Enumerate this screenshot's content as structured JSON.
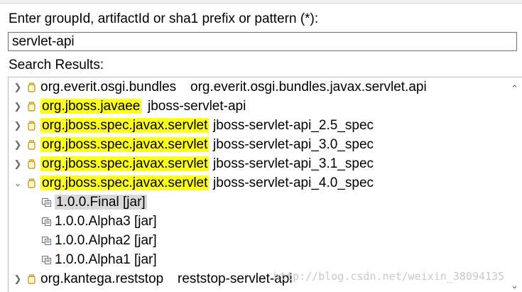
{
  "prompt_label": "Enter groupId, artifactId or sha1 prefix or pattern (*):",
  "search": {
    "value": "servlet-api"
  },
  "results_label": "Search Results:",
  "results": [
    {
      "group": "org.everit.osgi.bundles",
      "artifact": "org.everit.osgi.bundles.javax.servlet.api",
      "highlight": false,
      "expanded": false
    },
    {
      "group": "org.jboss.javaee",
      "artifact": "jboss-servlet-api",
      "highlight": true,
      "expanded": false
    },
    {
      "group": "org.jboss.spec.javax.servlet",
      "artifact": "jboss-servlet-api_2.5_spec",
      "highlight": true,
      "expanded": false
    },
    {
      "group": "org.jboss.spec.javax.servlet",
      "artifact": "jboss-servlet-api_3.0_spec",
      "highlight": true,
      "expanded": false
    },
    {
      "group": "org.jboss.spec.javax.servlet",
      "artifact": "jboss-servlet-api_3.1_spec",
      "highlight": true,
      "expanded": false
    },
    {
      "group": "org.jboss.spec.javax.servlet",
      "artifact": "jboss-servlet-api_4.0_spec",
      "highlight": true,
      "expanded": true
    },
    {
      "group": "org.kantega.reststop",
      "artifact": "reststop-servlet-api",
      "highlight": false,
      "expanded": false
    }
  ],
  "versions": [
    {
      "label": "1.0.0.Final [jar]",
      "selected": true
    },
    {
      "label": "1.0.0.Alpha3 [jar]",
      "selected": false
    },
    {
      "label": "1.0.0.Alpha2 [jar]",
      "selected": false
    },
    {
      "label": "1.0.0.Alpha1 [jar]",
      "selected": false
    }
  ],
  "icons": {
    "collapsed": "chevron-right-icon",
    "expanded": "chevron-down-icon",
    "jar": "jar-icon",
    "version": "version-file-icon"
  },
  "colors": {
    "highlight": "#ffff1c",
    "selection": "#d9d9d9",
    "jar_icon": "#e8c84a"
  },
  "watermark": "http://blog.csdn.net/weixin_38094135"
}
